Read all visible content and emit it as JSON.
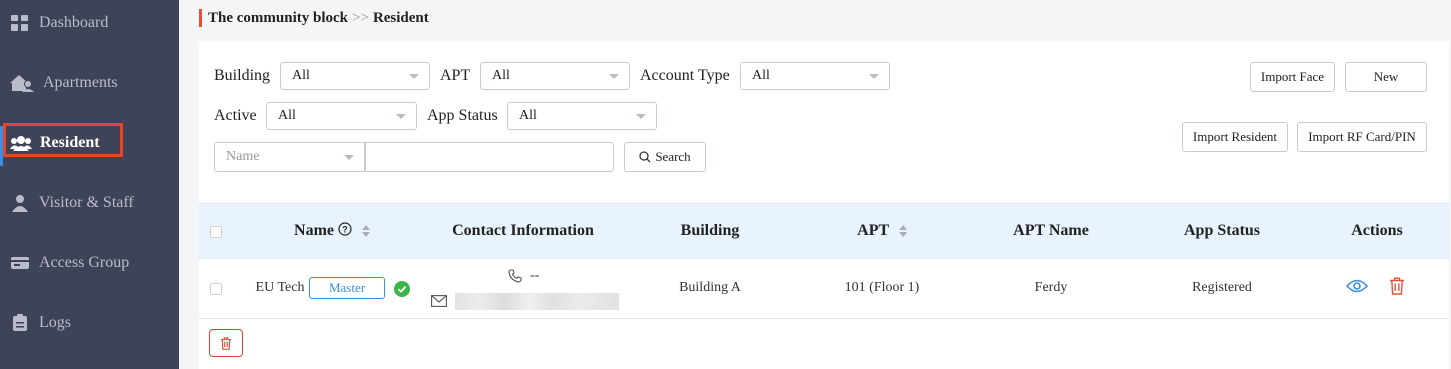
{
  "sidebar": {
    "items": [
      {
        "label": "Dashboard",
        "icon": "dashboard-icon"
      },
      {
        "label": "Apartments",
        "icon": "apartments-icon"
      },
      {
        "label": "Resident",
        "icon": "resident-icon",
        "active": true
      },
      {
        "label": "Visitor & Staff",
        "icon": "visitor-staff-icon"
      },
      {
        "label": "Access Group",
        "icon": "access-group-icon"
      },
      {
        "label": "Logs",
        "icon": "logs-icon"
      }
    ]
  },
  "breadcrumb": {
    "parent": "The community block",
    "separator": ">>",
    "current": "Resident"
  },
  "filters": {
    "building": {
      "label": "Building",
      "value": "All"
    },
    "apt": {
      "label": "APT",
      "value": "All"
    },
    "account_type": {
      "label": "Account Type",
      "value": "All"
    },
    "active": {
      "label": "Active",
      "value": "All"
    },
    "app_status": {
      "label": "App Status",
      "value": "All"
    },
    "search_field": {
      "placeholder": "Name"
    },
    "search_input": {
      "value": ""
    },
    "search_button": "Search"
  },
  "actions": {
    "import_face": "Import Face",
    "new": "New",
    "import_resident": "Import Resident",
    "import_rf": "Import RF Card/PIN"
  },
  "table": {
    "columns": [
      "Name",
      "Contact Information",
      "Building",
      "APT",
      "APT Name",
      "App Status",
      "Actions"
    ],
    "rows": [
      {
        "name": "EU Tech",
        "role": "Master",
        "phone": "--",
        "building": "Building A",
        "apt": "101 (Floor 1)",
        "apt_name": "Ferdy",
        "app_status": "Registered"
      }
    ]
  },
  "colors": {
    "sidebar": "#3f4357",
    "accent": "#3b8fe0",
    "danger": "#e5503b",
    "success": "#3cb64a",
    "header_bg": "#e8f3fd"
  }
}
